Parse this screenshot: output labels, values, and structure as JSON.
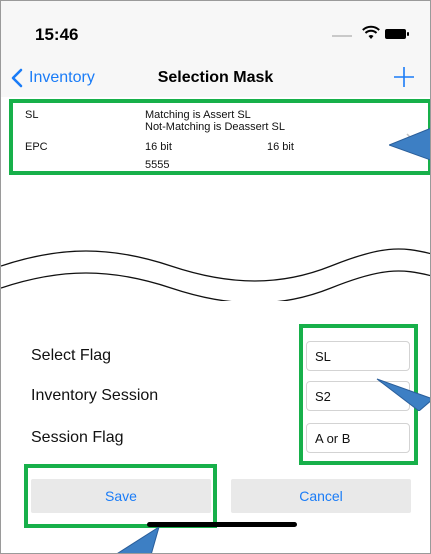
{
  "status_bar": {
    "time": "15:46",
    "icons": [
      "signal-icon",
      "wifi-icon",
      "battery-icon"
    ]
  },
  "navbar": {
    "back_label": "Inventory",
    "title": "Selection Mask",
    "add_icon": "plus-icon"
  },
  "mask_row": {
    "target": "SL",
    "action_line1": "Matching is Assert SL",
    "action_line2": "Not-Matching is Deassert SL",
    "bank": "EPC",
    "offset": "16 bit",
    "length": "16 bit",
    "mask": "5555"
  },
  "form": {
    "select_flag_label": "Select Flag",
    "select_flag_value": "SL",
    "inventory_session_label": "Inventory Session",
    "inventory_session_value": "S2",
    "session_flag_label": "Session Flag",
    "session_flag_value": "A or B"
  },
  "actions": {
    "save_label": "Save",
    "cancel_label": "Cancel"
  },
  "colors": {
    "accent": "#1a7cf7",
    "highlight": "#17b04a",
    "callout": "#3d7fc4"
  }
}
